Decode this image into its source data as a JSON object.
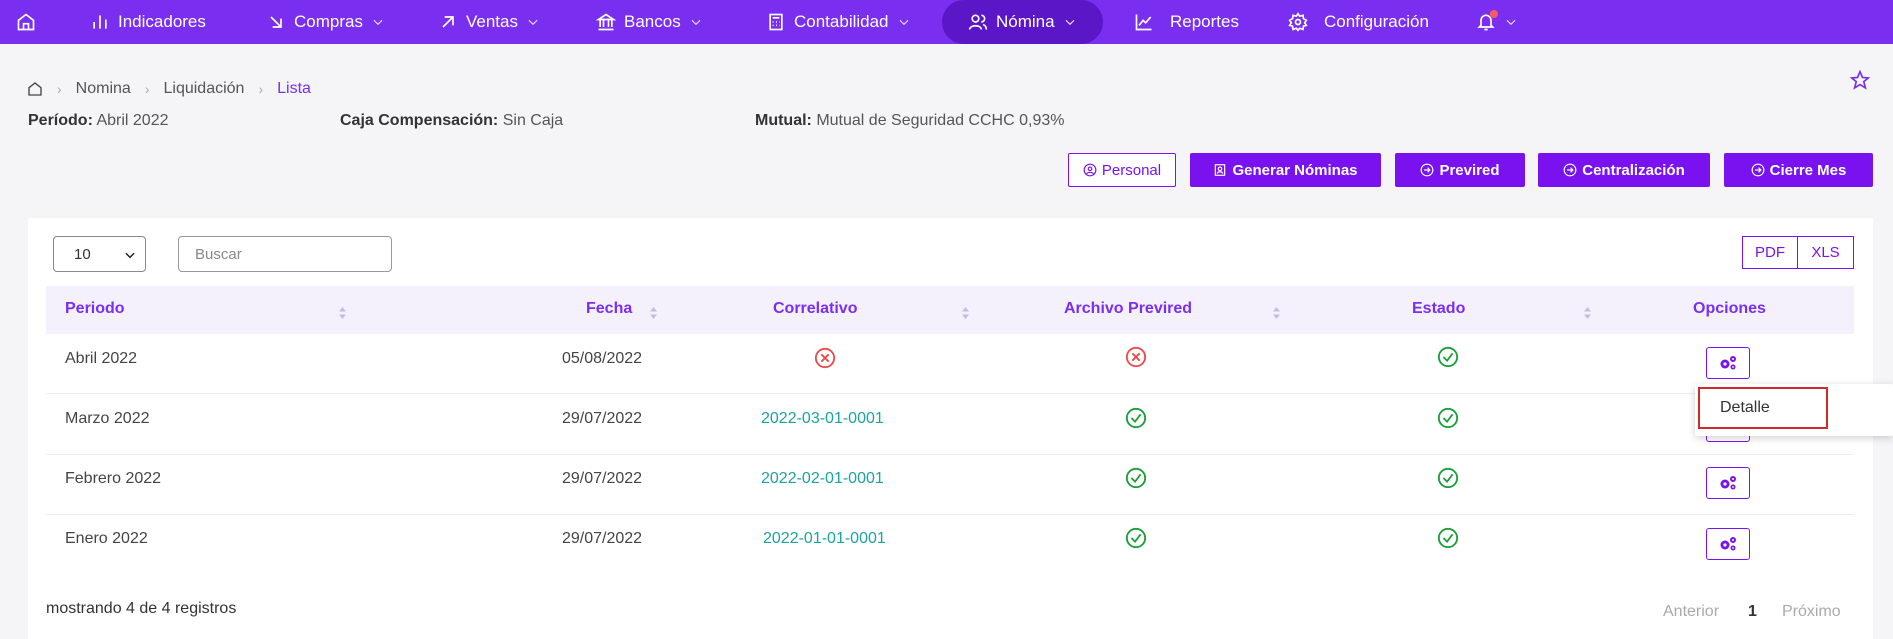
{
  "nav": {
    "items": [
      {
        "label": "Indicadores"
      },
      {
        "label": "Compras"
      },
      {
        "label": "Ventas"
      },
      {
        "label": "Bancos"
      },
      {
        "label": "Contabilidad"
      },
      {
        "label": "Nómina"
      },
      {
        "label": "Reportes"
      },
      {
        "label": "Configuración"
      }
    ],
    "accent": "#7a2ff0"
  },
  "breadcrumb": {
    "items": [
      "Nomina",
      "Liquidación"
    ],
    "current": "Lista"
  },
  "info": {
    "periodo_label": "Período:",
    "periodo_value": "Abril 2022",
    "caja_label": "Caja Compensación:",
    "caja_value": "Sin Caja",
    "mutual_label": "Mutual:",
    "mutual_value": "Mutual de Seguridad CCHC 0,93%"
  },
  "actions": {
    "personal": "Personal",
    "generar": "Generar Nóminas",
    "previred": "Previred",
    "centralizacion": "Centralización",
    "cierre": "Cierre Mes"
  },
  "controls": {
    "page_size": "10",
    "search_placeholder": "Buscar",
    "pdf": "PDF",
    "xls": "XLS"
  },
  "table": {
    "headers": {
      "periodo": "Periodo",
      "fecha": "Fecha",
      "correlativo": "Correlativo",
      "archivo": "Archivo Previred",
      "estado": "Estado",
      "opciones": "Opciones"
    },
    "rows": [
      {
        "periodo": "Abril 2022",
        "fecha": "05/08/2022",
        "correlativo": "",
        "correlativo_status": "error",
        "archivo": "error",
        "estado": "ok"
      },
      {
        "periodo": "Marzo 2022",
        "fecha": "29/07/2022",
        "correlativo": "2022-03-01-0001",
        "archivo": "ok",
        "estado": "ok"
      },
      {
        "periodo": "Febrero 2022",
        "fecha": "29/07/2022",
        "correlativo": "2022-02-01-0001",
        "archivo": "ok",
        "estado": "ok"
      },
      {
        "periodo": "Enero 2022",
        "fecha": "29/07/2022",
        "correlativo": "2022-01-01-0001",
        "archivo": "ok",
        "estado": "ok"
      }
    ]
  },
  "dropdown": {
    "detalle": "Detalle"
  },
  "footer": {
    "showing": "mostrando 4 de 4 registros",
    "prev": "Anterior",
    "page": "1",
    "next": "Próximo"
  }
}
